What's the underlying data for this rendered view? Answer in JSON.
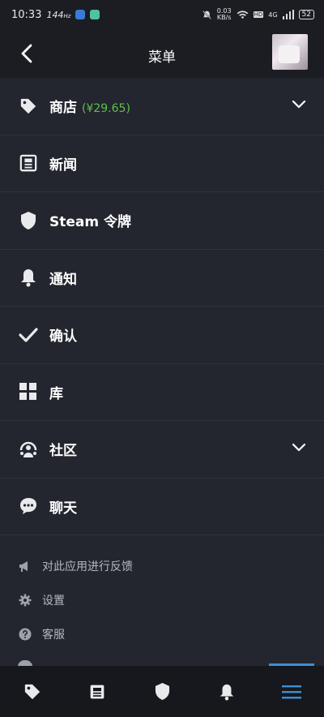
{
  "status_bar": {
    "time": "10:33",
    "refresh_rate": "144",
    "refresh_unit": "Hz",
    "net_speed": "0.03",
    "net_unit": "KB/s",
    "signal": "4G",
    "battery": "52"
  },
  "header": {
    "title": "菜单"
  },
  "menu": [
    {
      "label": "商店",
      "price": "(¥29.65)",
      "icon": "tag-icon",
      "expandable": true
    },
    {
      "label": "新闻",
      "icon": "newspaper-icon",
      "expandable": false
    },
    {
      "label": "Steam 令牌",
      "icon": "shield-icon",
      "expandable": false
    },
    {
      "label": "通知",
      "icon": "bell-icon",
      "expandable": false
    },
    {
      "label": "确认",
      "icon": "checkmark-icon",
      "expandable": false
    },
    {
      "label": "库",
      "icon": "grid-icon",
      "expandable": false
    },
    {
      "label": "社区",
      "icon": "community-icon",
      "expandable": true
    },
    {
      "label": "聊天",
      "icon": "chat-icon",
      "expandable": false
    }
  ],
  "secondary": [
    {
      "label": "对此应用进行反馈",
      "icon": "megaphone-icon"
    },
    {
      "label": "设置",
      "icon": "gear-icon"
    },
    {
      "label": "客服",
      "icon": "help-icon"
    }
  ],
  "bottom_nav": [
    {
      "icon": "tag-icon",
      "active": false
    },
    {
      "icon": "newspaper-icon",
      "active": false
    },
    {
      "icon": "shield-icon",
      "active": false
    },
    {
      "icon": "bell-icon",
      "active": false
    },
    {
      "icon": "hamburger-menu-icon",
      "active": true
    }
  ],
  "colors": {
    "background": "#23262e",
    "header": "#1b1d23",
    "price_green": "#5fbf4c",
    "active_blue": "#3d8fd6"
  }
}
